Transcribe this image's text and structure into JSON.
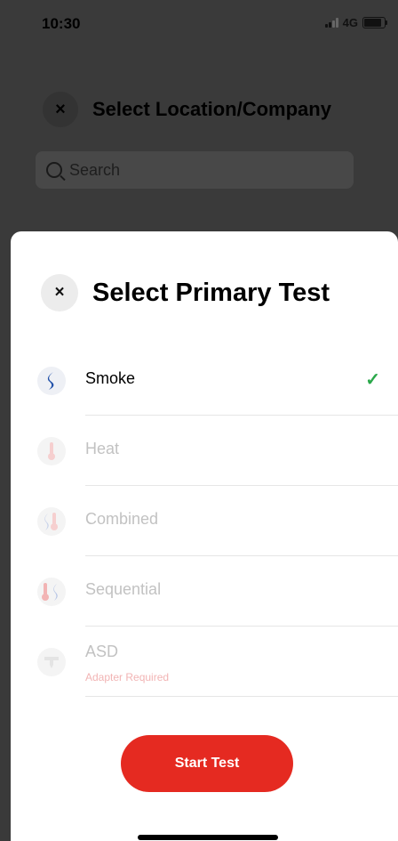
{
  "status_bar": {
    "time": "10:30",
    "network": "4G"
  },
  "background": {
    "close_icon": "×",
    "title": "Select Location/Company",
    "search_placeholder": "Search"
  },
  "sheet": {
    "close_icon": "×",
    "title": "Select Primary Test",
    "tests": [
      {
        "label": "Smoke",
        "sub": "",
        "state": "selected",
        "icon": "smoke-icon",
        "check": "✓"
      },
      {
        "label": "Heat",
        "sub": "",
        "state": "disabled",
        "icon": "heat-icon"
      },
      {
        "label": "Combined",
        "sub": "",
        "state": "disabled",
        "icon": "combined-icon"
      },
      {
        "label": "Sequential",
        "sub": "",
        "state": "disabled",
        "icon": "sequential-icon"
      },
      {
        "label": "ASD",
        "sub": "Adapter Required",
        "state": "disabled",
        "icon": "asd-icon"
      }
    ],
    "start_button": "Start Test"
  },
  "colors": {
    "accent": "#e52a21",
    "check": "#2aa84a",
    "smoke_blue": "#1f4fa8",
    "heat_red": "#e05a5a"
  }
}
